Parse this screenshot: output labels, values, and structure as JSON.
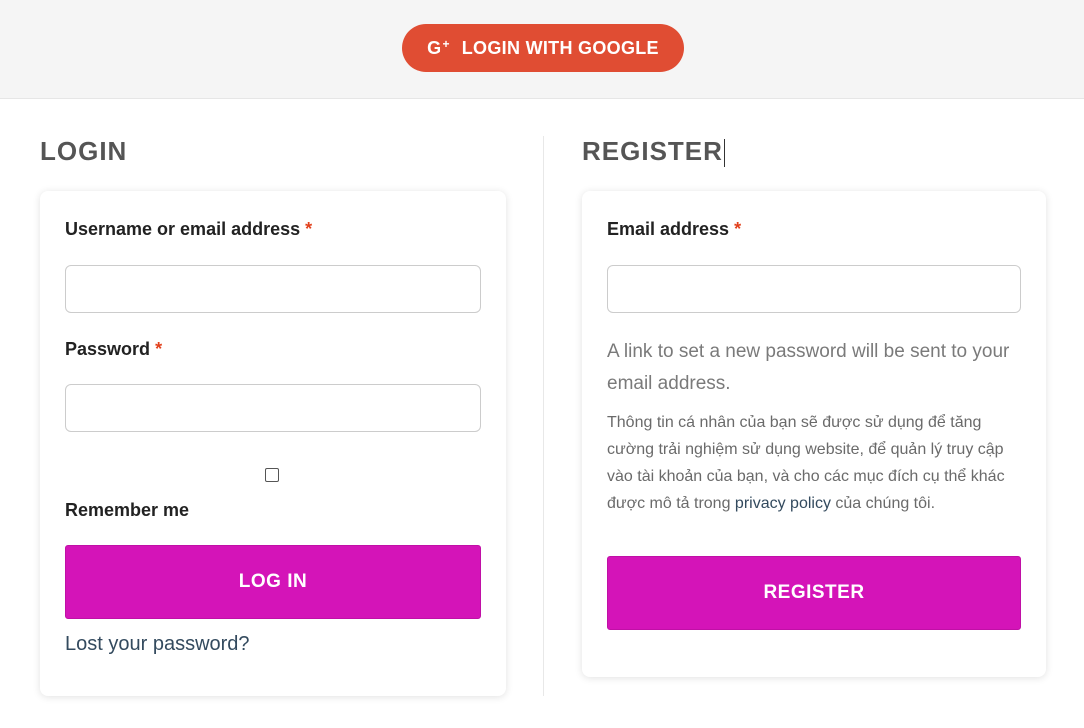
{
  "header": {
    "google_icon": "G+",
    "google_login_label": "LOGIN WITH GOOGLE"
  },
  "login": {
    "title": "LOGIN",
    "username_label": "Username or email address",
    "password_label": "Password",
    "required_mark": "*",
    "remember_label": "Remember me",
    "submit_label": "LOG IN",
    "lost_password_label": "Lost your password?"
  },
  "register": {
    "title": "REGISTER",
    "email_label": "Email address",
    "required_mark": "*",
    "info_text": "A link to set a new password will be sent to your email address.",
    "privacy_before": "Thông tin cá nhân của bạn sẽ được sử dụng để tăng cường trải nghiệm sử dụng website, để quản lý truy cập vào tài khoản của bạn, và cho các mục đích cụ thể khác được mô tả trong ",
    "privacy_link": "privacy policy",
    "privacy_after": " của chúng tôi.",
    "submit_label": "REGISTER"
  },
  "colors": {
    "google": "#e04d33",
    "primary_button": "#d414b8",
    "required": "#e2401c"
  }
}
